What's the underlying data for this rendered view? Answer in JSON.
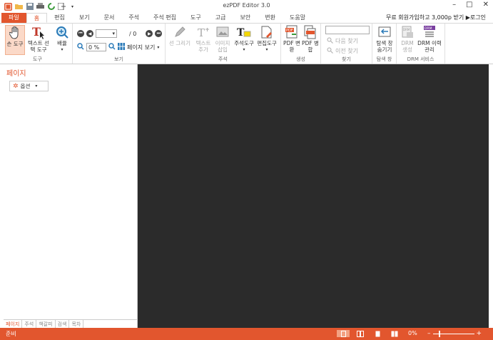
{
  "app": {
    "title": "ezPDF Editor 3.0"
  },
  "window_controls": {
    "minimize": "–",
    "maximize": "□",
    "close": "✕"
  },
  "tabs": [
    {
      "label": "파일"
    },
    {
      "label": "홈"
    },
    {
      "label": "편집"
    },
    {
      "label": "보기"
    },
    {
      "label": "문서"
    },
    {
      "label": "주석"
    },
    {
      "label": "주석 편집"
    },
    {
      "label": "도구"
    },
    {
      "label": "고급"
    },
    {
      "label": "보안"
    },
    {
      "label": "변환"
    },
    {
      "label": "도움말"
    }
  ],
  "promo": "무료 회원가입하고 3,000p 받기 ▶로그인",
  "ribbon": {
    "tools": {
      "hand": "손 도구",
      "text_select": "텍스트 선택 도구",
      "zoom": "배율",
      "label": "도구"
    },
    "view": {
      "page_num": "",
      "page_total": "/ 0",
      "zoom_value": "0 %",
      "page_view": "페이지 보기",
      "label": "보기"
    },
    "annot": {
      "line": "선 그리기",
      "text_add": "텍스트 추가",
      "image_add": "이미지 삽입",
      "annot_tool": "주석도구",
      "edit_tool": "편집도구",
      "label": "주석"
    },
    "create": {
      "pdf_convert": "PDF 변환",
      "pdf_merge": "PDF 병합",
      "label": "생성"
    },
    "find": {
      "next": "다음 찾기",
      "prev": "이전 찾기",
      "label": "찾기"
    },
    "explorer": {
      "btn": "탐색 창 숨기기",
      "label": "탐색 창"
    },
    "drm": {
      "create": "DRM 생성",
      "history": "DRM 이력 관리",
      "label": "DRM 서비스"
    }
  },
  "sidebar": {
    "title": "페이지",
    "options": "옵션",
    "tabs": [
      {
        "label": "페이지"
      },
      {
        "label": "주석"
      },
      {
        "label": "책갈피"
      },
      {
        "label": "검색"
      },
      {
        "label": "목차"
      }
    ]
  },
  "status": {
    "ready": "준비",
    "zoom": "0%",
    "minus": "–",
    "plus": "+"
  },
  "colors": {
    "accent": "#e2562e",
    "canvas": "#2b2b2b"
  }
}
